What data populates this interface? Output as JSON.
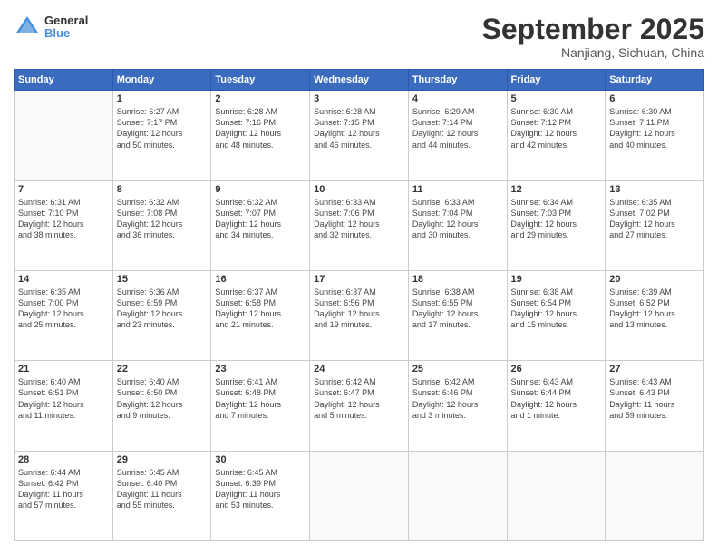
{
  "header": {
    "logo_line1": "General",
    "logo_line2": "Blue",
    "month": "September 2025",
    "location": "Nanjiang, Sichuan, China"
  },
  "days_of_week": [
    "Sunday",
    "Monday",
    "Tuesday",
    "Wednesday",
    "Thursday",
    "Friday",
    "Saturday"
  ],
  "weeks": [
    [
      {
        "day": "",
        "info": ""
      },
      {
        "day": "1",
        "info": "Sunrise: 6:27 AM\nSunset: 7:17 PM\nDaylight: 12 hours\nand 50 minutes."
      },
      {
        "day": "2",
        "info": "Sunrise: 6:28 AM\nSunset: 7:16 PM\nDaylight: 12 hours\nand 48 minutes."
      },
      {
        "day": "3",
        "info": "Sunrise: 6:28 AM\nSunset: 7:15 PM\nDaylight: 12 hours\nand 46 minutes."
      },
      {
        "day": "4",
        "info": "Sunrise: 6:29 AM\nSunset: 7:14 PM\nDaylight: 12 hours\nand 44 minutes."
      },
      {
        "day": "5",
        "info": "Sunrise: 6:30 AM\nSunset: 7:12 PM\nDaylight: 12 hours\nand 42 minutes."
      },
      {
        "day": "6",
        "info": "Sunrise: 6:30 AM\nSunset: 7:11 PM\nDaylight: 12 hours\nand 40 minutes."
      }
    ],
    [
      {
        "day": "7",
        "info": "Sunrise: 6:31 AM\nSunset: 7:10 PM\nDaylight: 12 hours\nand 38 minutes."
      },
      {
        "day": "8",
        "info": "Sunrise: 6:32 AM\nSunset: 7:08 PM\nDaylight: 12 hours\nand 36 minutes."
      },
      {
        "day": "9",
        "info": "Sunrise: 6:32 AM\nSunset: 7:07 PM\nDaylight: 12 hours\nand 34 minutes."
      },
      {
        "day": "10",
        "info": "Sunrise: 6:33 AM\nSunset: 7:06 PM\nDaylight: 12 hours\nand 32 minutes."
      },
      {
        "day": "11",
        "info": "Sunrise: 6:33 AM\nSunset: 7:04 PM\nDaylight: 12 hours\nand 30 minutes."
      },
      {
        "day": "12",
        "info": "Sunrise: 6:34 AM\nSunset: 7:03 PM\nDaylight: 12 hours\nand 29 minutes."
      },
      {
        "day": "13",
        "info": "Sunrise: 6:35 AM\nSunset: 7:02 PM\nDaylight: 12 hours\nand 27 minutes."
      }
    ],
    [
      {
        "day": "14",
        "info": "Sunrise: 6:35 AM\nSunset: 7:00 PM\nDaylight: 12 hours\nand 25 minutes."
      },
      {
        "day": "15",
        "info": "Sunrise: 6:36 AM\nSunset: 6:59 PM\nDaylight: 12 hours\nand 23 minutes."
      },
      {
        "day": "16",
        "info": "Sunrise: 6:37 AM\nSunset: 6:58 PM\nDaylight: 12 hours\nand 21 minutes."
      },
      {
        "day": "17",
        "info": "Sunrise: 6:37 AM\nSunset: 6:56 PM\nDaylight: 12 hours\nand 19 minutes."
      },
      {
        "day": "18",
        "info": "Sunrise: 6:38 AM\nSunset: 6:55 PM\nDaylight: 12 hours\nand 17 minutes."
      },
      {
        "day": "19",
        "info": "Sunrise: 6:38 AM\nSunset: 6:54 PM\nDaylight: 12 hours\nand 15 minutes."
      },
      {
        "day": "20",
        "info": "Sunrise: 6:39 AM\nSunset: 6:52 PM\nDaylight: 12 hours\nand 13 minutes."
      }
    ],
    [
      {
        "day": "21",
        "info": "Sunrise: 6:40 AM\nSunset: 6:51 PM\nDaylight: 12 hours\nand 11 minutes."
      },
      {
        "day": "22",
        "info": "Sunrise: 6:40 AM\nSunset: 6:50 PM\nDaylight: 12 hours\nand 9 minutes."
      },
      {
        "day": "23",
        "info": "Sunrise: 6:41 AM\nSunset: 6:48 PM\nDaylight: 12 hours\nand 7 minutes."
      },
      {
        "day": "24",
        "info": "Sunrise: 6:42 AM\nSunset: 6:47 PM\nDaylight: 12 hours\nand 5 minutes."
      },
      {
        "day": "25",
        "info": "Sunrise: 6:42 AM\nSunset: 6:46 PM\nDaylight: 12 hours\nand 3 minutes."
      },
      {
        "day": "26",
        "info": "Sunrise: 6:43 AM\nSunset: 6:44 PM\nDaylight: 12 hours\nand 1 minute."
      },
      {
        "day": "27",
        "info": "Sunrise: 6:43 AM\nSunset: 6:43 PM\nDaylight: 11 hours\nand 59 minutes."
      }
    ],
    [
      {
        "day": "28",
        "info": "Sunrise: 6:44 AM\nSunset: 6:42 PM\nDaylight: 11 hours\nand 57 minutes."
      },
      {
        "day": "29",
        "info": "Sunrise: 6:45 AM\nSunset: 6:40 PM\nDaylight: 11 hours\nand 55 minutes."
      },
      {
        "day": "30",
        "info": "Sunrise: 6:45 AM\nSunset: 6:39 PM\nDaylight: 11 hours\nand 53 minutes."
      },
      {
        "day": "",
        "info": ""
      },
      {
        "day": "",
        "info": ""
      },
      {
        "day": "",
        "info": ""
      },
      {
        "day": "",
        "info": ""
      }
    ]
  ]
}
